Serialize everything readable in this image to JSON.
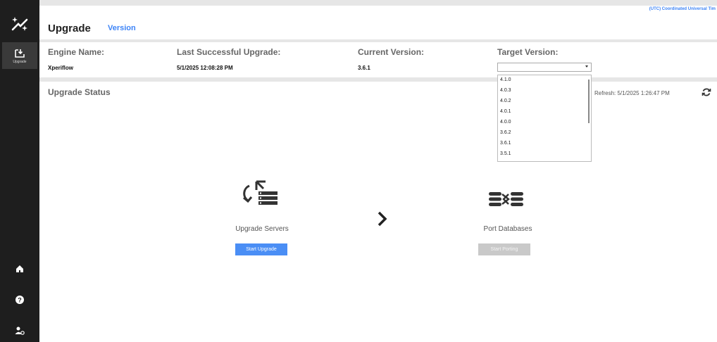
{
  "sidebar": {
    "active_item": {
      "label": "Upgrade",
      "icon": "upgrade-icon"
    },
    "bottom_icons": [
      "home-icon",
      "help-icon",
      "user-settings-icon"
    ]
  },
  "header": {
    "title": "Upgrade",
    "version_link": "Version",
    "timezone": "(UTC) Coordinated Universal Tim"
  },
  "info": {
    "engine_name_label": "Engine Name:",
    "engine_name_value": "Xperiflow",
    "last_upgrade_label": "Last Successful Upgrade:",
    "last_upgrade_value": "5/1/2025 12:08:28 PM",
    "current_version_label": "Current Version:",
    "current_version_value": "3.6.1",
    "target_version_label": "Target Version:",
    "target_version_value": "",
    "target_version_options": [
      "4.1.0",
      "4.0.3",
      "4.0.2",
      "4.0.1",
      "4.0.0",
      "3.6.2",
      "3.6.1",
      "3.5.1"
    ]
  },
  "status": {
    "title": "Upgrade Status",
    "refresh_text": "Refresh: 5/1/2025 1:26:47 PM",
    "steps": [
      {
        "label": "Upgrade Servers",
        "button": "Start Upgrade",
        "enabled": true
      },
      {
        "label": "Port Databases",
        "button": "Start Porting",
        "enabled": false
      }
    ]
  },
  "colors": {
    "accent": "#3d84f7",
    "sidebar_bg": "#1e1e1e",
    "button_primary": "#4a8ef5",
    "button_disabled": "#c9c9c9"
  }
}
